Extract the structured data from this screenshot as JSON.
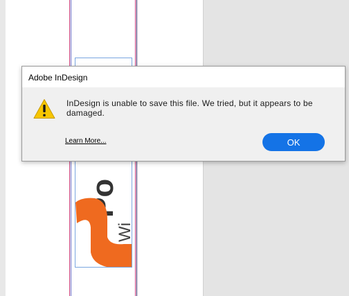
{
  "background": {
    "title_fragment": "Po",
    "subtitle_fragment": "Wi",
    "colors": {
      "page": "#ffffff",
      "pasteboard": "#e4e4e4",
      "frame_border": "#7aa6e0",
      "guide_magenta": "#c0397a",
      "guide_blue": "#6a6fc9",
      "logo": "#ef6a1f"
    }
  },
  "dialog": {
    "title": "Adobe InDesign",
    "icon": "warning-icon",
    "message": "InDesign is unable to save this file. We tried, but it appears to be damaged.",
    "learn_more": "Learn More...",
    "ok_label": "OK",
    "colors": {
      "ok_button": "#1473e6",
      "warning": "#f7c600"
    }
  }
}
